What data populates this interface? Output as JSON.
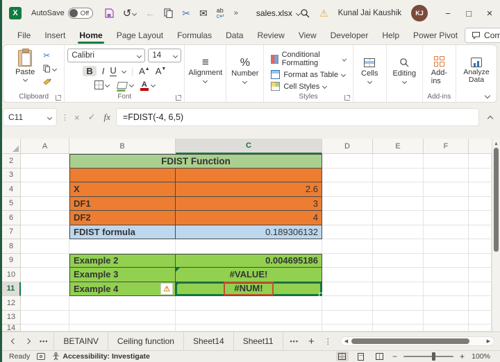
{
  "titlebar": {
    "autosave_label": "AutoSave",
    "autosave_state": "Off",
    "document_title": "sales.xlsx",
    "user_name": "Kunal Jai Kaushik",
    "user_initials": "KJ"
  },
  "ribbon_tabs": {
    "items": [
      "File",
      "Insert",
      "Home",
      "Page Layout",
      "Formulas",
      "Data",
      "Review",
      "View",
      "Developer",
      "Help",
      "Power Pivot"
    ],
    "active_tab": "Home",
    "comments_label": "Comments"
  },
  "ribbon": {
    "paste_label": "Paste",
    "clipboard_group": "Clipboard",
    "font_name": "Calibri",
    "font_size": "14",
    "bold": "B",
    "italic": "I",
    "underline": "U",
    "font_increase": "A",
    "font_decrease": "A",
    "font_color_letter": "A",
    "font_group": "Font",
    "alignment_label": "Alignment",
    "number_label": "Number",
    "conditional_formatting": "Conditional Formatting",
    "format_as_table": "Format as Table",
    "cell_styles": "Cell Styles",
    "styles_group": "Styles",
    "cells_label": "Cells",
    "editing_label": "Editing",
    "addins_label": "Add-ins",
    "addins_group": "Add-ins",
    "analyze_data_label": "Analyze Data"
  },
  "formula_bar": {
    "cell_reference": "C11",
    "formula": "=FDIST(-4, 6,5)"
  },
  "grid": {
    "column_headers": [
      "A",
      "B",
      "C",
      "D",
      "E",
      "F"
    ],
    "row_numbers": [
      "2",
      "3",
      "4",
      "5",
      "6",
      "7",
      "8",
      "9",
      "10",
      "11",
      "12",
      "13",
      "14"
    ],
    "selected_cell": "C11",
    "selected_column": "C",
    "selected_row": "11"
  },
  "sheet": {
    "table_title": "FDIST Function",
    "rows": [
      {
        "label": "X",
        "value": "2.6"
      },
      {
        "label": "DF1",
        "value": "3"
      },
      {
        "label": "DF2",
        "value": "4"
      },
      {
        "label": "FDIST formula",
        "value": "0.189306132"
      },
      {
        "label": "Example 2",
        "value": "0.004695186"
      },
      {
        "label": "Example 3",
        "value": "#VALUE!"
      },
      {
        "label": "Example 4",
        "value": "#NUM!"
      }
    ]
  },
  "sheet_tabs": {
    "items": [
      "BETAINV",
      "Ceiling function",
      "Sheet14",
      "Sheet11"
    ]
  },
  "status_bar": {
    "mode": "Ready",
    "accessibility_label": "Accessibility: Investigate",
    "zoom_level": "100%"
  },
  "colors": {
    "accent_green": "#107C41",
    "table_title_fill": "#A9D08E",
    "orange_fill": "#ED7D31",
    "formula_row_fill": "#BDD7EE",
    "example_fill": "#92D050",
    "error_outline": "#C0522D"
  }
}
